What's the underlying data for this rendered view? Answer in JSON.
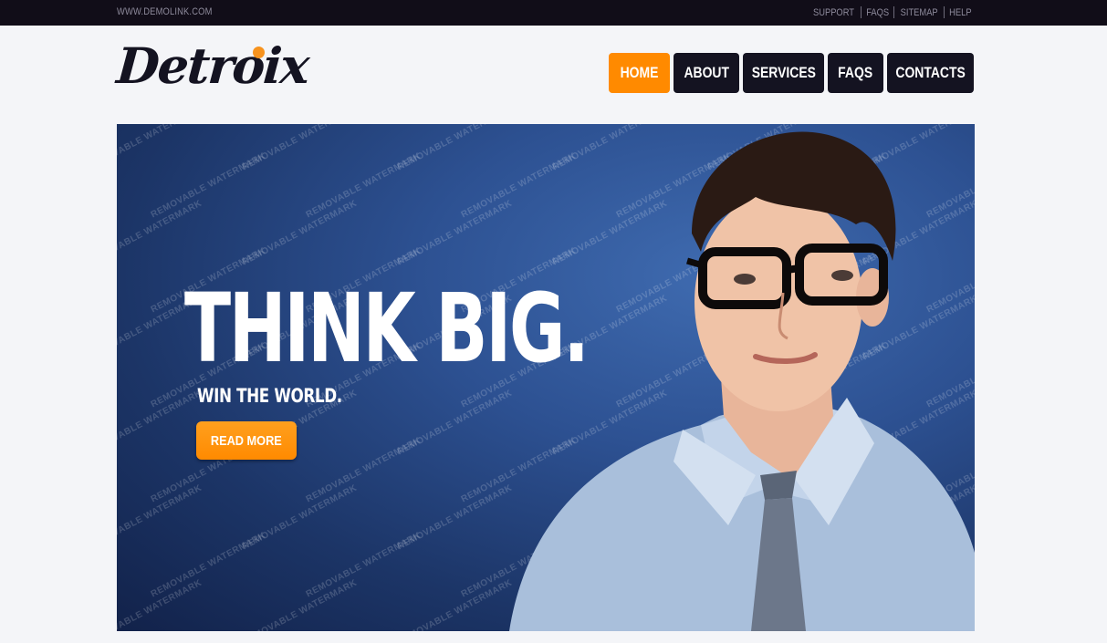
{
  "topbar": {
    "site_url": "WWW.DEMOLINK.COM",
    "links": [
      "SUPPORT",
      "FAQS",
      "SITEMAP",
      "HELP"
    ]
  },
  "logo": {
    "text": "Detroix",
    "dot_color": "#f7931e"
  },
  "nav": {
    "items": [
      "HOME",
      "ABOUT",
      "SERVICES",
      "FAQS",
      "CONTACTS"
    ],
    "active": "HOME",
    "active_color": "#ff8a00",
    "default_color": "#141321"
  },
  "hero": {
    "title": "THINK BIG.",
    "subtitle": "WIN THE WORLD.",
    "button_label": "READ MORE",
    "watermark_text": "REMOVABLE WATERMARK",
    "background_color": "#2d5192",
    "image_subject": "man-with-glasses-and-tie"
  },
  "colors": {
    "accent": "#ff8a00",
    "dark": "#141321",
    "page_bg": "#f4f5f8"
  }
}
